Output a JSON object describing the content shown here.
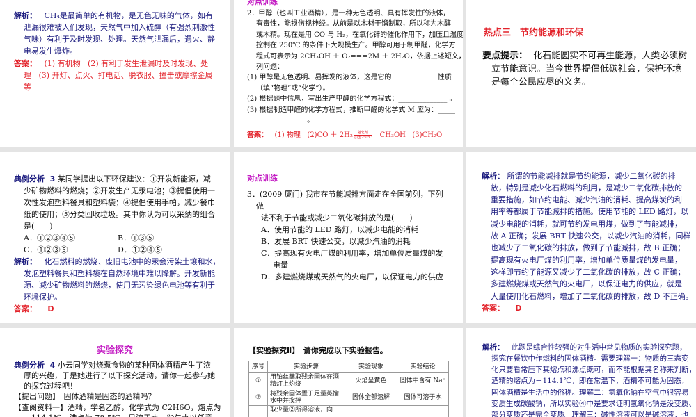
{
  "colors": {
    "navy": "#1a1a7e",
    "red": "#e3232b",
    "black": "#111111",
    "magenta": "#c41ec4"
  },
  "slides": [
    {
      "lines": [
        {
          "s": [
            {
              "t": "解析：",
              "c": "navy",
              "b": true
            },
            {
              "t": "   CH₄是最简单的有机物，是无色无味的气体，如有",
              "c": "navy"
            }
          ]
        },
        {
          "i": 1,
          "s": [
            {
              "t": "泄漏很难被人们发现，天然气中加入硫醇（有强烈刺激性",
              "c": "navy"
            }
          ]
        },
        {
          "i": 1,
          "s": [
            {
              "t": "气味）有利于及时发现、处理。天然气泄漏后，遇火、静",
              "c": "navy"
            }
          ]
        },
        {
          "i": 1,
          "s": [
            {
              "t": "电易发生爆炸。",
              "c": "navy"
            }
          ]
        },
        {
          "s": [
            {
              "t": "答案：",
              "c": "red",
              "b": true
            },
            {
              "t": "   (1) 有机物   (2) 有利于发生泄漏时及时发现、处",
              "c": "red"
            }
          ]
        },
        {
          "i": 1,
          "s": [
            {
              "t": "理   (3) 开灯、点火、打电话、脱衣服、撞击或摩擦金属",
              "c": "red"
            }
          ]
        },
        {
          "i": 1,
          "s": [
            {
              "t": "等",
              "c": "red"
            }
          ]
        }
      ]
    },
    {
      "title": "对点训练",
      "lines": [
        {
          "s": [
            {
              "t": "2．甲醇（也叫工业酒精），是一种无色透明、具有挥发性的液体，",
              "c": "black"
            }
          ]
        },
        {
          "i": 1,
          "s": [
            {
              "t": "有毒性，能损伤视神经。从前是以木材干馏制取，所以称为木醇",
              "c": "black"
            }
          ]
        },
        {
          "i": 1,
          "s": [
            {
              "t": "或木精。现在是用 CO 与 H₂，在氧化锌的催化作用下，加压且温度",
              "c": "black"
            }
          ]
        },
        {
          "i": 1,
          "s": [
            {
              "t": "控制在 250℃ 的条件下大规模生产。甲醇可用于制甲醛，化学方",
              "c": "black"
            }
          ]
        },
        {
          "i": 1,
          "s": [
            {
              "t": "程式可表示为 2CH₃OH ＋ O₂===2M ＋ 2H₂O，依据上述短文，回答下",
              "c": "black"
            }
          ]
        },
        {
          "i": 1,
          "s": [
            {
              "t": "列问题：",
              "c": "black"
            }
          ]
        },
        {
          "s": [
            {
              "t": "(1) 甲醇是无色透明、易挥发的液体，这是它的 ____________ 性质",
              "c": "black"
            }
          ]
        },
        {
          "i": 1,
          "s": [
            {
              "t": "（填“物理”或“化学”）。",
              "c": "black"
            }
          ]
        },
        {
          "s": [
            {
              "t": "(2) 根据题中信息，写出生产甲醇的化学方程式：______________ 。",
              "c": "black"
            }
          ]
        },
        {
          "s": [
            {
              "t": "(3) 根据制造甲醛的化学方程式，推断甲醛的化学式 M 应为：_____",
              "c": "black"
            }
          ]
        },
        {
          "i": 1,
          "s": [
            {
              "t": "______________ 。",
              "c": "black"
            }
          ]
        },
        {
          "answer": true,
          "s": [
            {
              "t": "答案：",
              "c": "red",
              "b": true
            },
            {
              "t": "   (1) 物理   (2)CO ＋ 2H₂",
              "c": "red"
            },
            {
              "cond": [
                "催化剂",
                "加压250℃"
              ],
              "c": "red"
            },
            {
              "t": "   CH₃OH   (3)CH₂O",
              "c": "red"
            }
          ]
        }
      ]
    },
    {
      "title": "热点三　节约能源和环保",
      "lines": [
        {
          "s": [
            {
              "t": "要点提示：",
              "c": "black",
              "b": true
            },
            {
              "t": "  化石能圆实不可再生能源，人类必须树",
              "c": "black"
            }
          ]
        },
        {
          "i": 1,
          "s": [
            {
              "t": "立节能意识。当今世界提倡低碳社会，保护环境",
              "c": "black"
            }
          ]
        },
        {
          "i": 1,
          "s": [
            {
              "t": "是每个公民应尽的义务。",
              "c": "black"
            }
          ]
        }
      ]
    },
    {
      "lines": [
        {
          "s": [
            {
              "t": "典例分析  3",
              "c": "navy",
              "b": true
            },
            {
              "t": " 某同学提出以下环保建议：①开发新能源，减",
              "c": "black"
            }
          ]
        },
        {
          "i": 1,
          "s": [
            {
              "t": "少矿物燃料的燃烧；②开发生产无汞电池；③提倡使用一",
              "c": "black"
            }
          ]
        },
        {
          "i": 1,
          "s": [
            {
              "t": "次性发泡塑料餐具和塑料袋；④提倡使用手帕，减少餐巾",
              "c": "black"
            }
          ]
        },
        {
          "i": 1,
          "s": [
            {
              "t": "纸的使用；⑤分类回收垃圾。其中你认为可以采纳的组合",
              "c": "black"
            }
          ]
        },
        {
          "i": 1,
          "s": [
            {
              "t": "是(　　)",
              "c": "black"
            }
          ]
        },
        {
          "i": 1,
          "s": [
            {
              "t": "A．①②③④⑤",
              "c": "black"
            },
            {
              "t": "B．①③⑤",
              "c": "black",
              "p": true
            }
          ]
        },
        {
          "i": 1,
          "s": [
            {
              "t": "C．①②③⑤",
              "c": "black"
            },
            {
              "t": "D．①②④⑤",
              "c": "black",
              "p": true
            }
          ]
        },
        {
          "s": [
            {
              "t": "解析：",
              "c": "navy",
              "b": true
            },
            {
              "t": "   化石燃料的燃烧、废旧电池中的汞会污染土壤和水，",
              "c": "navy"
            }
          ]
        },
        {
          "i": 1,
          "s": [
            {
              "t": "发泡塑料餐具和塑料袋在自然环境中难以降解。开发新能",
              "c": "navy"
            }
          ]
        },
        {
          "i": 1,
          "s": [
            {
              "t": "源、减少矿物燃料的燃烧，使用无污染绿色电池等有利于",
              "c": "navy"
            }
          ]
        },
        {
          "i": 1,
          "s": [
            {
              "t": "环境保护。",
              "c": "navy"
            }
          ]
        },
        {
          "s": [
            {
              "t": "答案：",
              "c": "red",
              "b": true
            },
            {
              "t": "    D",
              "c": "red",
              "b": true
            }
          ]
        }
      ]
    },
    {
      "title": "对点训练",
      "lines": [
        {
          "s": [
            {
              "t": "3．(2009 厦门) 我市在节能减排方面走在全国前列，下列",
              "c": "black"
            }
          ]
        },
        {
          "i": 1,
          "s": [
            {
              "t": "做",
              "c": "black"
            }
          ]
        },
        {
          "i": 2,
          "s": [
            {
              "t": "法不利于节能或减少二氧化碳排放的是(　　)",
              "c": "black"
            }
          ]
        },
        {
          "i": 2,
          "s": [
            {
              "t": "A．使用节能的 LED 路灯，以减少电能的消耗",
              "c": "black"
            }
          ]
        },
        {
          "i": 2,
          "s": [
            {
              "t": "B．发展 BRT 快速公交，以减少汽油的消耗",
              "c": "black"
            }
          ]
        },
        {
          "i": 2,
          "s": [
            {
              "t": "C．提高现有火电厂煤的利用率，增加单位质量煤的发",
              "c": "black"
            }
          ]
        },
        {
          "i": 3,
          "s": [
            {
              "t": "电量",
              "c": "black"
            }
          ]
        },
        {
          "i": 2,
          "s": [
            {
              "t": "D．多建燃烧煤或天然气的火电厂，以保证电力的供应",
              "c": "black"
            }
          ]
        }
      ]
    },
    {
      "lines": [
        {
          "s": [
            {
              "t": "解析：",
              "c": "navy",
              "b": true
            },
            {
              "t": " 所谓的节能减排就是节约能源，减少二氧化碳的排",
              "c": "navy"
            }
          ]
        },
        {
          "i": 1,
          "s": [
            {
              "t": "放，特别是减少化石燃料的利用，是减少二氧化碳排放的",
              "c": "navy"
            }
          ]
        },
        {
          "i": 1,
          "s": [
            {
              "t": "重要措施，如节约电能、减少汽油的消耗、提高煤炭的利",
              "c": "navy"
            }
          ]
        },
        {
          "i": 1,
          "s": [
            {
              "t": "用率等都属于节能减排的措施。使用节能的 LED 路灯，以",
              "c": "navy"
            }
          ]
        },
        {
          "i": 1,
          "s": [
            {
              "t": "减少电能的消耗，就可节约发电用煤，做到了节能减排，",
              "c": "navy"
            }
          ]
        },
        {
          "i": 1,
          "s": [
            {
              "t": "故 A 正确；发展 BRT 快速公交，以减少汽油的消耗，同样",
              "c": "navy"
            }
          ]
        },
        {
          "i": 1,
          "s": [
            {
              "t": "也减少了二氧化碳的排放，做到了节能减排，故 B 正确；",
              "c": "navy"
            }
          ]
        },
        {
          "i": 1,
          "s": [
            {
              "t": "提高现有火电厂煤的利用率，增加单位质量煤的发电量，",
              "c": "navy"
            }
          ]
        },
        {
          "i": 1,
          "s": [
            {
              "t": "这样即节约了能源又减少了二氧化碳的排放，故 C 正确；",
              "c": "navy"
            }
          ]
        },
        {
          "i": 1,
          "s": [
            {
              "t": "多建燃烧煤或天然气的火电厂，以保证电力的供应，就是",
              "c": "navy"
            }
          ]
        },
        {
          "i": 1,
          "s": [
            {
              "t": "大量使用化石燃料，增加了二氧化碳的排放，故 D 不正确。",
              "c": "navy"
            }
          ]
        },
        {
          "s": [
            {
              "t": "答案：",
              "c": "red",
              "b": true
            },
            {
              "t": "    D",
              "c": "red",
              "b": true
            }
          ]
        }
      ]
    },
    {
      "title": "实验探究",
      "lines": [
        {
          "s": [
            {
              "t": "典例分析  4",
              "c": "navy",
              "b": true
            },
            {
              "t": " 小云同学对烧煮食物的某种固体酒精产生了浓",
              "c": "black"
            }
          ]
        },
        {
          "i": 1,
          "s": [
            {
              "t": "厚的兴趣，于是她进行了以下探究活动，请你一起参与她",
              "c": "black"
            }
          ]
        },
        {
          "i": 1,
          "s": [
            {
              "t": "的探究过程吧！",
              "c": "black"
            }
          ]
        },
        {
          "s": [
            {
              "t": "【提出问题】　固体酒精是固态的酒精吗？",
              "c": "black"
            }
          ]
        },
        {
          "s": [
            {
              "t": "【查阅资料一】酒精，学名乙醇，化学式为 C2H6O，熔点为",
              "c": "black"
            }
          ]
        },
        {
          "i": 1,
          "s": [
            {
              "t": "－114.1℃，沸点为 78.5℃，易溶于水，能与水以任意",
              "c": "black"
            }
          ]
        }
      ]
    },
    {
      "title": "【实验探究Ⅱ】　请你完成以下实验报告。",
      "table": {
        "headers": [
          "序号",
          "实验步骤",
          "实验现象",
          "实验结论"
        ],
        "rows": [
          [
            "①",
            "用铂丝蘸取残余固体在酒精灯上灼烧",
            "火焰呈黄色",
            "固体中含有 Na⁺"
          ],
          [
            "②",
            "将残余固体置于足量蒸馏水中并搅拌",
            "固体全部溶解",
            "固体可溶于水"
          ],
          [
            "",
            "取少量②所得溶液，向",
            "",
            ""
          ]
        ]
      }
    },
    {
      "lines": [
        {
          "s": [
            {
              "t": "解析：",
              "c": "navy",
              "b": true
            },
            {
              "t": "   此题是综合性较强的对生活中常见物质的实验探究题，",
              "c": "navy"
            }
          ]
        },
        {
          "i": 1,
          "s": [
            {
              "t": "探究在餐饮中作燃料的固体酒精。需要理解一：物质的三态变",
              "c": "navy"
            }
          ]
        },
        {
          "i": 1,
          "s": [
            {
              "t": "化只要看常压下其熔点和沸点既可，而不能根据其名称来判断，",
              "c": "navy"
            }
          ]
        },
        {
          "i": 1,
          "s": [
            {
              "t": "酒精的熔点为－114.1℃，即在常温下，酒精不可能为固态，",
              "c": "navy"
            }
          ]
        },
        {
          "i": 1,
          "s": [
            {
              "t": "固体酒精是生活中的俗称。理解二：氢氧化钠在空气中很容易",
              "c": "navy"
            }
          ]
        },
        {
          "i": 1,
          "s": [
            {
              "t": "变质生成碳酸钠，所以实验④中是要求证明氢氧化钠是没变质、",
              "c": "navy"
            }
          ]
        },
        {
          "i": 1,
          "s": [
            {
              "t": "部分变质还是完全变质。理解三：碱性溶液可以是碱溶液，也",
              "c": "navy"
            }
          ]
        }
      ]
    }
  ]
}
